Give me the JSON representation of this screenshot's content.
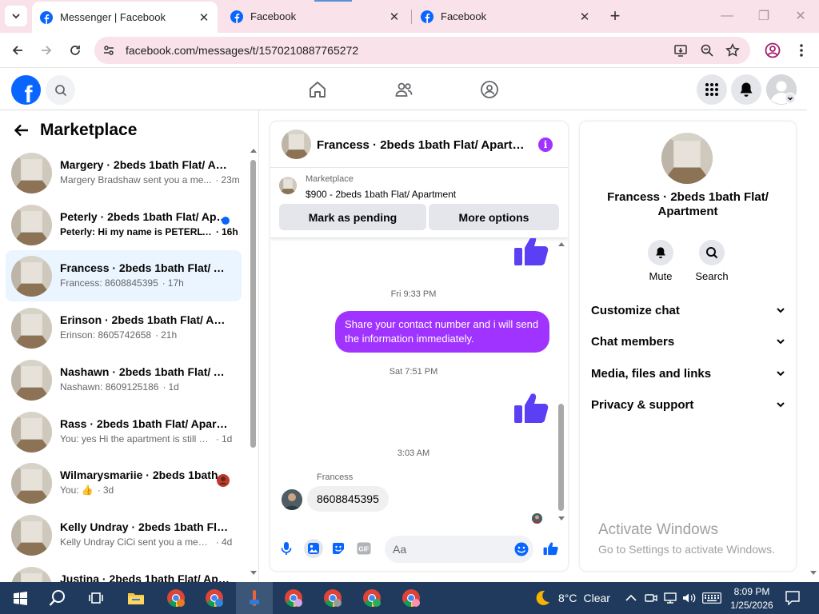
{
  "browser": {
    "tabs": [
      {
        "title": "Messenger | Facebook",
        "active": true
      },
      {
        "title": "Facebook",
        "active": false
      },
      {
        "title": "Facebook",
        "active": false
      }
    ],
    "url": "facebook.com/messages/t/1570210887765272"
  },
  "colors": {
    "fb_blue": "#0866ff",
    "accent_purple": "#a033ff",
    "taskbar": "#1f3a5c",
    "tab_strip": "#f9e2ea"
  },
  "facebook_nav": {
    "logo": "f",
    "icons": [
      "search-icon",
      "home-icon",
      "friends-icon",
      "groups-icon",
      "menu-grid-icon",
      "notifications-bell-icon",
      "account-avatar"
    ]
  },
  "sidebar": {
    "title": "Marketplace",
    "conversations": [
      {
        "title": "Margery · 2beds 1bath Flat/ Apa...",
        "snippet": "Margery Bradshaw sent you a me...",
        "time": "23m",
        "unread": false,
        "selected": false
      },
      {
        "title": "Peterly · 2beds 1bath Flat/ Apa...",
        "snippet": "Peterly: Hi my name is PETERLY...",
        "time": "16h",
        "unread": true,
        "selected": false
      },
      {
        "title": "Francess · 2beds 1bath Flat/ Apa...",
        "snippet": "Francess: 8608845395",
        "time": "17h",
        "unread": false,
        "selected": true
      },
      {
        "title": "Erinson · 2beds 1bath Flat/ Apar...",
        "snippet": "Erinson: 8605742658",
        "time": "21h",
        "unread": false,
        "selected": false
      },
      {
        "title": "Nashawn · 2beds 1bath Flat/ Ap...",
        "snippet": "Nashawn: 8609125186",
        "time": "1d",
        "unread": false,
        "selected": false
      },
      {
        "title": "Rass · 2beds 1bath Flat/ Apartm...",
        "snippet": "You: yes Hi the apartment is still av...",
        "time": "1d",
        "unread": false,
        "selected": false
      },
      {
        "title": "Wilmarysmariie · 2beds 1bath...",
        "snippet": "You: 👍",
        "time": "3d",
        "unread": false,
        "selected": false
      },
      {
        "title": "Kelly Undray · 2beds 1bath Flat/ ...",
        "snippet": "Kelly Undray CiCi sent you a messa...",
        "time": "4d",
        "unread": false,
        "selected": false
      },
      {
        "title": "Justina · 2beds 1bath Flat/ Apart...",
        "snippet": "",
        "time": "",
        "unread": false,
        "selected": false
      }
    ]
  },
  "chat": {
    "header_title": "Francess · 2beds 1bath Flat/ Apartm...",
    "marketplace": {
      "label": "Marketplace",
      "listing": "$900 - 2beds 1bath Flat/ Apartment",
      "mark_pending": "Mark as pending",
      "more_options": "More options"
    },
    "messages": {
      "ts1": "Fri 9:33 PM",
      "outgoing_text": "Share your contact number and i will send the information immediately.",
      "ts2": "Sat 7:51 PM",
      "ts3": "3:03 AM",
      "sender_name": "Francess",
      "incoming_text": "8608845395"
    },
    "composer": {
      "placeholder": "Aa",
      "icons": [
        "microphone-icon",
        "photo-icon",
        "sticker-icon",
        "gif-icon",
        "emoji-icon",
        "like-icon"
      ]
    }
  },
  "details": {
    "name": "Francess · 2beds 1bath Flat/ Apartment",
    "actions": {
      "mute": "Mute",
      "search": "Search"
    },
    "sections": [
      "Customize chat",
      "Chat members",
      "Media, files and links",
      "Privacy & support"
    ]
  },
  "watermark": {
    "line1": "Activate Windows",
    "line2": "Go to Settings to activate Windows."
  },
  "taskbar": {
    "weather_temp": "8°C",
    "weather_cond": "Clear",
    "time": "8:09 PM",
    "date": "1/25/2026"
  }
}
